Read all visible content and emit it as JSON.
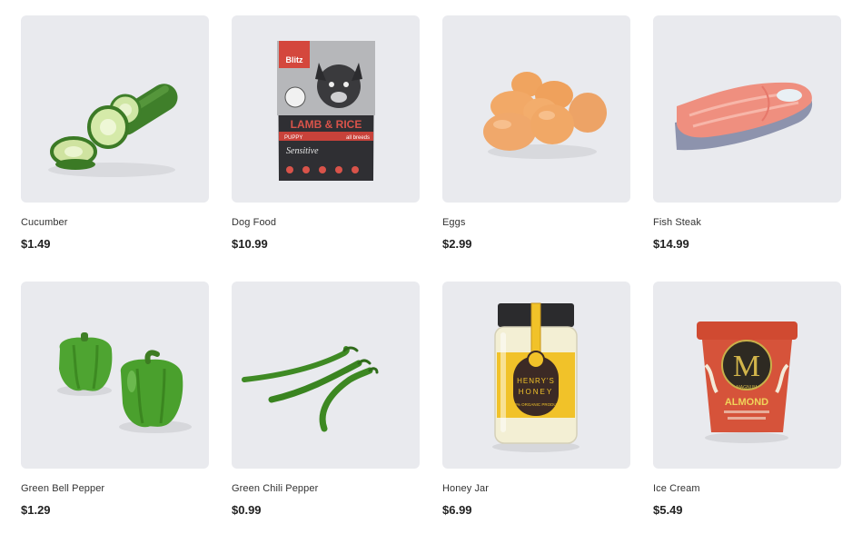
{
  "products": [
    {
      "name": "Cucumber",
      "price": "$1.49",
      "icon": "cucumber-icon"
    },
    {
      "name": "Dog Food",
      "price": "$10.99",
      "icon": "dog-food-bag-icon",
      "package_text": {
        "brand": "Blitz",
        "product": "LAMB & RICE",
        "line": "Sensitive",
        "sub_left": "PUPPY",
        "sub_right": "all breeds"
      }
    },
    {
      "name": "Eggs",
      "price": "$2.99",
      "icon": "eggs-icon"
    },
    {
      "name": "Fish Steak",
      "price": "$14.99",
      "icon": "fish-steak-icon"
    },
    {
      "name": "Green Bell Pepper",
      "price": "$1.29",
      "icon": "bell-pepper-icon"
    },
    {
      "name": "Green Chili Pepper",
      "price": "$0.99",
      "icon": "chili-pepper-icon"
    },
    {
      "name": "Honey Jar",
      "price": "$6.99",
      "icon": "honey-jar-icon",
      "package_text": {
        "brand": "HENRY'S",
        "product": "HONEY",
        "note": "100% ORGANIC PRODUCT"
      }
    },
    {
      "name": "Ice Cream",
      "price": "$5.49",
      "icon": "ice-cream-tub-icon",
      "package_text": {
        "brand": "MAGNUM",
        "flavor": "ALMOND"
      }
    }
  ]
}
